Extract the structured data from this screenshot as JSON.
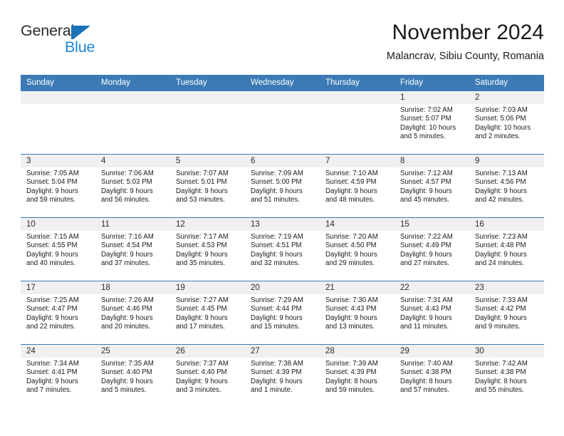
{
  "branding": {
    "name_part1": "General",
    "name_part2": "Blue"
  },
  "header": {
    "month_title": "November 2024",
    "location": "Malancrav, Sibiu County, Romania"
  },
  "calendar": {
    "weekday_headers": [
      "Sunday",
      "Monday",
      "Tuesday",
      "Wednesday",
      "Thursday",
      "Friday",
      "Saturday"
    ],
    "accent_color": "#3b7ab5",
    "day_band_color": "#f0f0f0",
    "weeks": [
      [
        {
          "day": "",
          "sunrise": "",
          "sunset": "",
          "daylight_line1": "",
          "daylight_line2": ""
        },
        {
          "day": "",
          "sunrise": "",
          "sunset": "",
          "daylight_line1": "",
          "daylight_line2": ""
        },
        {
          "day": "",
          "sunrise": "",
          "sunset": "",
          "daylight_line1": "",
          "daylight_line2": ""
        },
        {
          "day": "",
          "sunrise": "",
          "sunset": "",
          "daylight_line1": "",
          "daylight_line2": ""
        },
        {
          "day": "",
          "sunrise": "",
          "sunset": "",
          "daylight_line1": "",
          "daylight_line2": ""
        },
        {
          "day": "1",
          "sunrise": "Sunrise: 7:02 AM",
          "sunset": "Sunset: 5:07 PM",
          "daylight_line1": "Daylight: 10 hours",
          "daylight_line2": "and 5 minutes."
        },
        {
          "day": "2",
          "sunrise": "Sunrise: 7:03 AM",
          "sunset": "Sunset: 5:06 PM",
          "daylight_line1": "Daylight: 10 hours",
          "daylight_line2": "and 2 minutes."
        }
      ],
      [
        {
          "day": "3",
          "sunrise": "Sunrise: 7:05 AM",
          "sunset": "Sunset: 5:04 PM",
          "daylight_line1": "Daylight: 9 hours",
          "daylight_line2": "and 59 minutes."
        },
        {
          "day": "4",
          "sunrise": "Sunrise: 7:06 AM",
          "sunset": "Sunset: 5:03 PM",
          "daylight_line1": "Daylight: 9 hours",
          "daylight_line2": "and 56 minutes."
        },
        {
          "day": "5",
          "sunrise": "Sunrise: 7:07 AM",
          "sunset": "Sunset: 5:01 PM",
          "daylight_line1": "Daylight: 9 hours",
          "daylight_line2": "and 53 minutes."
        },
        {
          "day": "6",
          "sunrise": "Sunrise: 7:09 AM",
          "sunset": "Sunset: 5:00 PM",
          "daylight_line1": "Daylight: 9 hours",
          "daylight_line2": "and 51 minutes."
        },
        {
          "day": "7",
          "sunrise": "Sunrise: 7:10 AM",
          "sunset": "Sunset: 4:59 PM",
          "daylight_line1": "Daylight: 9 hours",
          "daylight_line2": "and 48 minutes."
        },
        {
          "day": "8",
          "sunrise": "Sunrise: 7:12 AM",
          "sunset": "Sunset: 4:57 PM",
          "daylight_line1": "Daylight: 9 hours",
          "daylight_line2": "and 45 minutes."
        },
        {
          "day": "9",
          "sunrise": "Sunrise: 7:13 AM",
          "sunset": "Sunset: 4:56 PM",
          "daylight_line1": "Daylight: 9 hours",
          "daylight_line2": "and 42 minutes."
        }
      ],
      [
        {
          "day": "10",
          "sunrise": "Sunrise: 7:15 AM",
          "sunset": "Sunset: 4:55 PM",
          "daylight_line1": "Daylight: 9 hours",
          "daylight_line2": "and 40 minutes."
        },
        {
          "day": "11",
          "sunrise": "Sunrise: 7:16 AM",
          "sunset": "Sunset: 4:54 PM",
          "daylight_line1": "Daylight: 9 hours",
          "daylight_line2": "and 37 minutes."
        },
        {
          "day": "12",
          "sunrise": "Sunrise: 7:17 AM",
          "sunset": "Sunset: 4:53 PM",
          "daylight_line1": "Daylight: 9 hours",
          "daylight_line2": "and 35 minutes."
        },
        {
          "day": "13",
          "sunrise": "Sunrise: 7:19 AM",
          "sunset": "Sunset: 4:51 PM",
          "daylight_line1": "Daylight: 9 hours",
          "daylight_line2": "and 32 minutes."
        },
        {
          "day": "14",
          "sunrise": "Sunrise: 7:20 AM",
          "sunset": "Sunset: 4:50 PM",
          "daylight_line1": "Daylight: 9 hours",
          "daylight_line2": "and 29 minutes."
        },
        {
          "day": "15",
          "sunrise": "Sunrise: 7:22 AM",
          "sunset": "Sunset: 4:49 PM",
          "daylight_line1": "Daylight: 9 hours",
          "daylight_line2": "and 27 minutes."
        },
        {
          "day": "16",
          "sunrise": "Sunrise: 7:23 AM",
          "sunset": "Sunset: 4:48 PM",
          "daylight_line1": "Daylight: 9 hours",
          "daylight_line2": "and 24 minutes."
        }
      ],
      [
        {
          "day": "17",
          "sunrise": "Sunrise: 7:25 AM",
          "sunset": "Sunset: 4:47 PM",
          "daylight_line1": "Daylight: 9 hours",
          "daylight_line2": "and 22 minutes."
        },
        {
          "day": "18",
          "sunrise": "Sunrise: 7:26 AM",
          "sunset": "Sunset: 4:46 PM",
          "daylight_line1": "Daylight: 9 hours",
          "daylight_line2": "and 20 minutes."
        },
        {
          "day": "19",
          "sunrise": "Sunrise: 7:27 AM",
          "sunset": "Sunset: 4:45 PM",
          "daylight_line1": "Daylight: 9 hours",
          "daylight_line2": "and 17 minutes."
        },
        {
          "day": "20",
          "sunrise": "Sunrise: 7:29 AM",
          "sunset": "Sunset: 4:44 PM",
          "daylight_line1": "Daylight: 9 hours",
          "daylight_line2": "and 15 minutes."
        },
        {
          "day": "21",
          "sunrise": "Sunrise: 7:30 AM",
          "sunset": "Sunset: 4:43 PM",
          "daylight_line1": "Daylight: 9 hours",
          "daylight_line2": "and 13 minutes."
        },
        {
          "day": "22",
          "sunrise": "Sunrise: 7:31 AM",
          "sunset": "Sunset: 4:43 PM",
          "daylight_line1": "Daylight: 9 hours",
          "daylight_line2": "and 11 minutes."
        },
        {
          "day": "23",
          "sunrise": "Sunrise: 7:33 AM",
          "sunset": "Sunset: 4:42 PM",
          "daylight_line1": "Daylight: 9 hours",
          "daylight_line2": "and 9 minutes."
        }
      ],
      [
        {
          "day": "24",
          "sunrise": "Sunrise: 7:34 AM",
          "sunset": "Sunset: 4:41 PM",
          "daylight_line1": "Daylight: 9 hours",
          "daylight_line2": "and 7 minutes."
        },
        {
          "day": "25",
          "sunrise": "Sunrise: 7:35 AM",
          "sunset": "Sunset: 4:40 PM",
          "daylight_line1": "Daylight: 9 hours",
          "daylight_line2": "and 5 minutes."
        },
        {
          "day": "26",
          "sunrise": "Sunrise: 7:37 AM",
          "sunset": "Sunset: 4:40 PM",
          "daylight_line1": "Daylight: 9 hours",
          "daylight_line2": "and 3 minutes."
        },
        {
          "day": "27",
          "sunrise": "Sunrise: 7:38 AM",
          "sunset": "Sunset: 4:39 PM",
          "daylight_line1": "Daylight: 9 hours",
          "daylight_line2": "and 1 minute."
        },
        {
          "day": "28",
          "sunrise": "Sunrise: 7:39 AM",
          "sunset": "Sunset: 4:39 PM",
          "daylight_line1": "Daylight: 8 hours",
          "daylight_line2": "and 59 minutes."
        },
        {
          "day": "29",
          "sunrise": "Sunrise: 7:40 AM",
          "sunset": "Sunset: 4:38 PM",
          "daylight_line1": "Daylight: 8 hours",
          "daylight_line2": "and 57 minutes."
        },
        {
          "day": "30",
          "sunrise": "Sunrise: 7:42 AM",
          "sunset": "Sunset: 4:38 PM",
          "daylight_line1": "Daylight: 8 hours",
          "daylight_line2": "and 55 minutes."
        }
      ]
    ]
  }
}
